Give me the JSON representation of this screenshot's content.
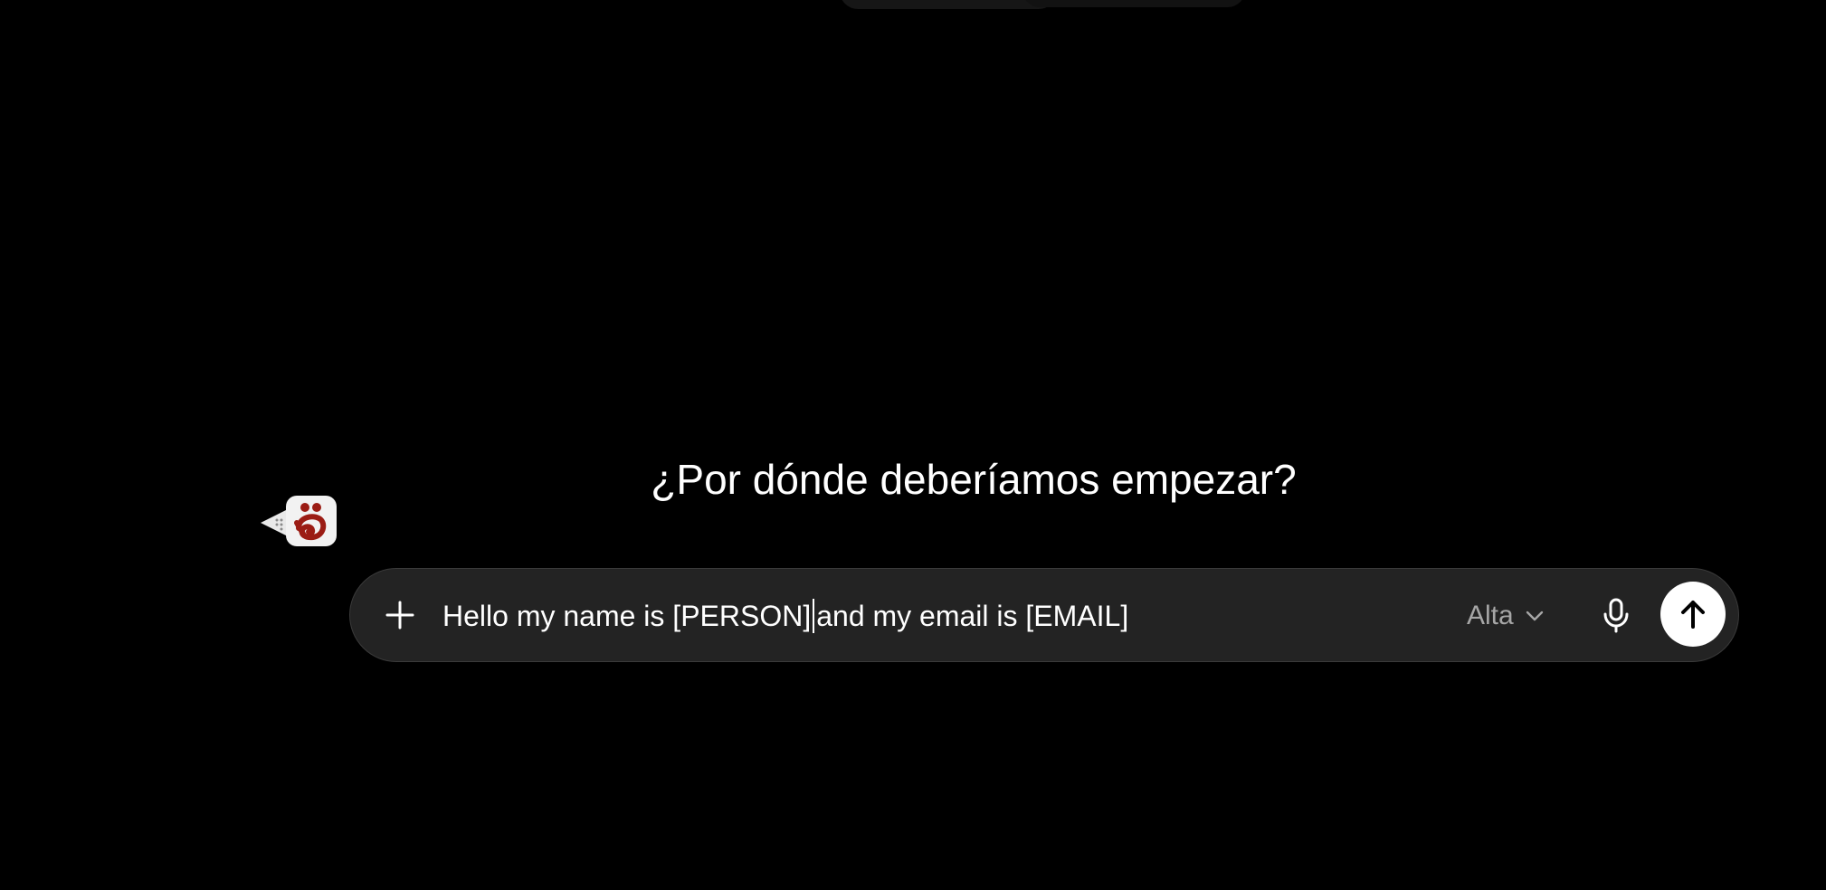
{
  "top_controls": [
    {
      "name": "top-pill-left"
    },
    {
      "name": "top-pill-right"
    }
  ],
  "headline": "¿Por dónde deberíamos empezar?",
  "composer": {
    "input_text_before_caret": "Hello my name is [PERSON]",
    "input_text_after_caret": "and my email is [EMAIL]",
    "model_label": "Alta",
    "icons": {
      "attach": "plus-icon",
      "model_dropdown": "chevron-down-icon",
      "voice": "microphone-icon",
      "send": "arrow-up-icon"
    }
  },
  "extension": {
    "icon": "extension-logo-icon"
  },
  "colors": {
    "background": "#000000",
    "composer_bg": "#232323",
    "text": "#ffffff",
    "muted_text": "#a6a6a6",
    "send_bg": "#ffffff",
    "logo_red": "#9b1c14"
  }
}
